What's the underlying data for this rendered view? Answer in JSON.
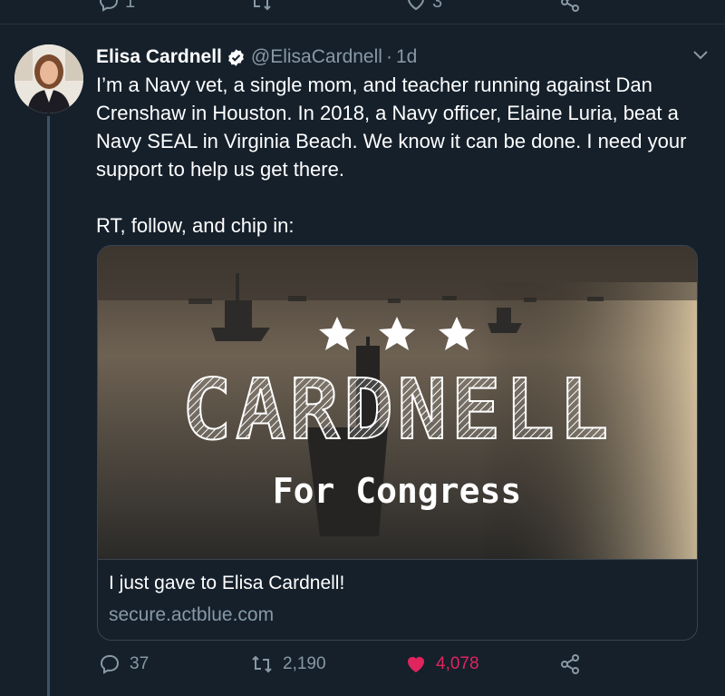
{
  "previous_tweet": {
    "reply_count": "1",
    "like_count": "3"
  },
  "tweet": {
    "author_name": "Elisa Cardnell",
    "handle": "@ElisaCardnell",
    "separator": "·",
    "time": "1d",
    "text_paragraph_1": "I’m a Navy vet, a single mom, and teacher running against Dan Crenshaw in Houston. In 2018, a Navy officer, Elaine Luria, beat a Navy SEAL in Virginia Beach. We know it can be done. I need your support to help us get there.",
    "text_paragraph_2": "RT, follow, and chip in:"
  },
  "card": {
    "image_headline": "CARDNELL",
    "image_subline": "For Congress",
    "title": "I just gave to Elisa Cardnell!",
    "domain": "secure.actblue.com"
  },
  "actions": {
    "reply_count": "37",
    "retweet_count": "2,190",
    "like_count": "4,078"
  },
  "colors": {
    "background": "#15202b",
    "text": "#ffffff",
    "muted": "#8899a6",
    "like": "#e0245e",
    "verified": "#ffffff"
  },
  "icons": [
    "reply-icon",
    "retweet-icon",
    "like-icon",
    "share-icon",
    "verified-icon",
    "chevron-down-icon"
  ]
}
